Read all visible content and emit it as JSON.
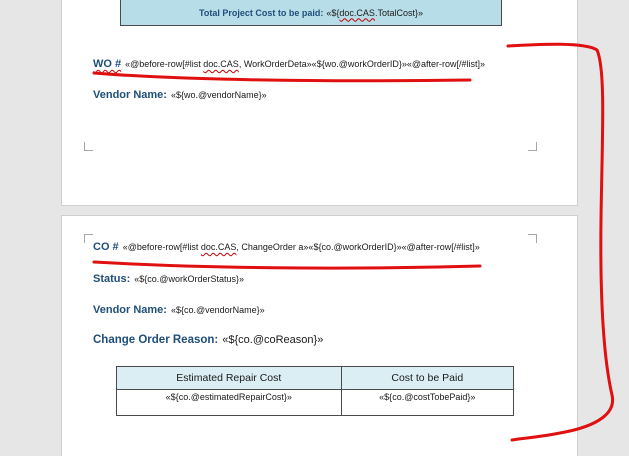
{
  "page1": {
    "total_label": "Total Project Cost to be paid:",
    "total_value": {
      "open": "«${",
      "squiggly": "doc.CAS",
      "close": ".TotalCost}»"
    },
    "wo_label": "WO #",
    "wo_value": {
      "part1": "«@before-row[#list ",
      "squiggly": "doc.CAS",
      "part2": ", WorkOrderDeta»«${wo.@workOrderID}»«@after-row[/#list]»"
    },
    "vendor_label": "Vendor Name:",
    "vendor_value": "«${wo.@vendorName}»"
  },
  "page2": {
    "co_label": "CO #",
    "co_value": {
      "part1": "«@before-row[#list ",
      "squiggly": "doc.CAS",
      "part2": ", ChangeOrder a»«${co.@workOrderID}»«@after-row[/#list]»"
    },
    "status_label": "Status:",
    "status_value": "«${co.@workOrderStatus}»",
    "vendor_label": "Vendor Name:",
    "vendor_value": "«${co.@vendorName}»",
    "reason_label": "Change Order Reason:",
    "reason_value": "«${co.@coReason}»",
    "table": {
      "headers": [
        "Estimated Repair Cost",
        "Cost to be Paid"
      ],
      "row": [
        "«${co.@estimatedRepairCost}»",
        "«${co.@costTobePaid}»"
      ]
    }
  },
  "colors": {
    "label_blue": "#1f4e79",
    "total_box_fill": "#b7dde8",
    "table_header_fill": "#dbeef4",
    "annotation_red": "#e01010"
  }
}
